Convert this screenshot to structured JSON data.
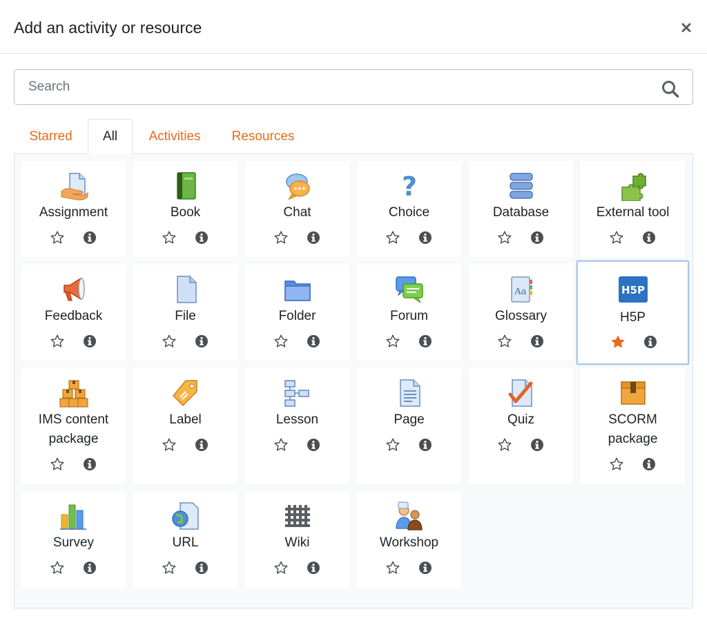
{
  "modal": {
    "title": "Add an activity or resource",
    "close_label": "×"
  },
  "search": {
    "placeholder": "Search",
    "value": ""
  },
  "tabs": [
    {
      "label": "Starred"
    },
    {
      "label": "All"
    },
    {
      "label": "Activities"
    },
    {
      "label": "Resources"
    }
  ],
  "colors": {
    "accent": "#e86b19",
    "star_active": "#e86b19",
    "info": "#4a4f54"
  },
  "items": [
    {
      "name": "Assignment",
      "lines": [
        "Assignment"
      ],
      "icon": "assignment-icon",
      "starred": false
    },
    {
      "name": "Book",
      "lines": [
        "Book"
      ],
      "icon": "book-icon",
      "starred": false
    },
    {
      "name": "Chat",
      "lines": [
        "Chat"
      ],
      "icon": "chat-icon",
      "starred": false
    },
    {
      "name": "Choice",
      "lines": [
        "Choice"
      ],
      "icon": "choice-icon",
      "starred": false
    },
    {
      "name": "Database",
      "lines": [
        "Database"
      ],
      "icon": "database-icon",
      "starred": false
    },
    {
      "name": "External tool",
      "lines": [
        "External tool"
      ],
      "icon": "puzzle-icon",
      "starred": false
    },
    {
      "name": "Feedback",
      "lines": [
        "Feedback"
      ],
      "icon": "megaphone-icon",
      "starred": false
    },
    {
      "name": "File",
      "lines": [
        "File"
      ],
      "icon": "file-icon",
      "starred": false
    },
    {
      "name": "Folder",
      "lines": [
        "Folder"
      ],
      "icon": "folder-icon",
      "starred": false
    },
    {
      "name": "Forum",
      "lines": [
        "Forum"
      ],
      "icon": "forum-icon",
      "starred": false
    },
    {
      "name": "Glossary",
      "lines": [
        "Glossary"
      ],
      "icon": "glossary-icon",
      "starred": false
    },
    {
      "name": "H5P",
      "lines": [
        "H5P"
      ],
      "icon": "h5p-icon",
      "starred": true
    },
    {
      "name": "IMS content package",
      "lines": [
        "IMS content",
        "package"
      ],
      "icon": "boxes-icon",
      "starred": false
    },
    {
      "name": "Label",
      "lines": [
        "Label"
      ],
      "icon": "tag-icon",
      "starred": false
    },
    {
      "name": "Lesson",
      "lines": [
        "Lesson"
      ],
      "icon": "lesson-icon",
      "starred": false
    },
    {
      "name": "Page",
      "lines": [
        "Page"
      ],
      "icon": "page-icon",
      "starred": false
    },
    {
      "name": "Quiz",
      "lines": [
        "Quiz"
      ],
      "icon": "quiz-icon",
      "starred": false
    },
    {
      "name": "SCORM package",
      "lines": [
        "SCORM",
        "package"
      ],
      "icon": "scorm-icon",
      "starred": false
    },
    {
      "name": "Survey",
      "lines": [
        "Survey"
      ],
      "icon": "survey-icon",
      "starred": false
    },
    {
      "name": "URL",
      "lines": [
        "URL"
      ],
      "icon": "url-icon",
      "starred": false
    },
    {
      "name": "Wiki",
      "lines": [
        "Wiki"
      ],
      "icon": "wiki-icon",
      "starred": false
    },
    {
      "name": "Workshop",
      "lines": [
        "Workshop"
      ],
      "icon": "workshop-icon",
      "starred": false
    }
  ]
}
